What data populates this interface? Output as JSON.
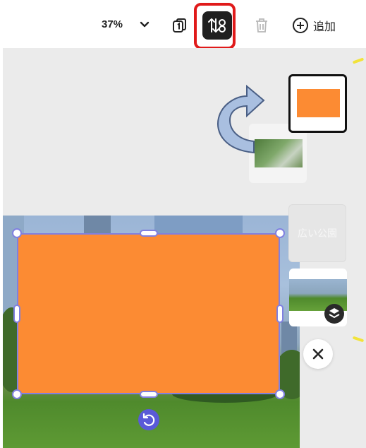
{
  "toolbar": {
    "zoom_label": "37%",
    "add_label": "追加"
  },
  "pages": {
    "thumb3_text": "広い公園"
  },
  "colors": {
    "accent": "#fc8b33",
    "selection": "#8080e0",
    "highlight": "#e01a1a"
  },
  "icons": [
    "chevron-down-icon",
    "pages-icon",
    "reorder-icon",
    "trash-icon",
    "plus-circle-icon",
    "rotate-icon",
    "layers-icon",
    "close-icon",
    "curved-arrow-icon"
  ]
}
